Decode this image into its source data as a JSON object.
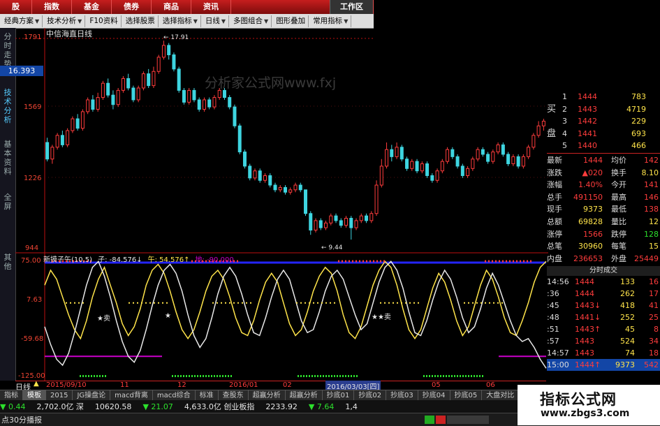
{
  "topbar": {
    "tabs": [
      "股",
      "指数",
      "基金",
      "债券",
      "商品",
      "资讯"
    ],
    "workspace": "工作区"
  },
  "toolbar": {
    "buttons": [
      "经典方案",
      "技术分析",
      "F10资料",
      "选择股票",
      "选择指标",
      "日线",
      "多图组合",
      "图形叠加",
      "常用指标"
    ]
  },
  "sidebar": {
    "labels": [
      "分时走势",
      "技术分析",
      "基本资料",
      "全屏",
      "其他"
    ],
    "price_tag": "16.393"
  },
  "chart": {
    "title": "中信海直日线",
    "y_labels": [
      "1791",
      "1569",
      "1226",
      "944"
    ],
    "high_label": "17.91",
    "low_label": "9.44",
    "faint_watermark": "分析家公式网www.fxj"
  },
  "indicator": {
    "legend": [
      "新摸子午(10,5)",
      "子: -84.576↓",
      "午: 54.576↑",
      "地: -90.000"
    ],
    "y_labels": [
      "75.00",
      "7.63",
      "-59.68",
      "-125.00"
    ],
    "annotations": [
      "★卖",
      "★",
      "★★卖"
    ]
  },
  "dates": {
    "period": "日线",
    "labels": [
      "2015/09/10",
      "11",
      "12",
      "2016/01",
      "02",
      "2016/03/03[四]",
      "05",
      "06"
    ]
  },
  "quote": {
    "book": [
      {
        "side": "",
        "level": "1",
        "price": "1444",
        "vol": "783"
      },
      {
        "side": "买",
        "level": "2",
        "price": "1443",
        "vol": "4719"
      },
      {
        "side": "",
        "level": "3",
        "price": "1442",
        "vol": "229"
      },
      {
        "side": "盘",
        "level": "4",
        "price": "1441",
        "vol": "693"
      },
      {
        "side": "",
        "level": "5",
        "price": "1440",
        "vol": "466"
      }
    ],
    "stats": [
      {
        "k1": "最新",
        "v1": "1444",
        "k2": "均价",
        "v2": "142"
      },
      {
        "k1": "涨跌",
        "v1": "▲020",
        "k2": "换手",
        "v2": "8.10"
      },
      {
        "k1": "涨幅",
        "v1": "1.40%",
        "k2": "今开",
        "v2": "141"
      },
      {
        "k1": "总手",
        "v1": "491150",
        "k2": "最高",
        "v2": "146"
      },
      {
        "k1": "现手",
        "v1": "9373",
        "k2": "最低",
        "v2": "138"
      },
      {
        "k1": "总额",
        "v1": "69828",
        "k2": "量比",
        "v2": "12"
      },
      {
        "k1": "涨停",
        "v1": "1566",
        "k2": "跌停",
        "v2": "128"
      },
      {
        "k1": "总笔",
        "v1": "30960",
        "k2": "每笔",
        "v2": "15"
      },
      {
        "k1": "内盘",
        "v1": "236653",
        "k2": "外盘",
        "v2": "25449"
      }
    ],
    "trades_title": "分时成交",
    "trades": [
      {
        "t": "14:56",
        "p": "1444",
        "v": "133",
        "n": "16"
      },
      {
        "t": ":36",
        "p": "1444",
        "v": "262",
        "n": "17"
      },
      {
        "t": ":45",
        "p": "1443↓",
        "v": "418",
        "n": "41"
      },
      {
        "t": ":48",
        "p": "1441↓",
        "v": "252",
        "n": "25"
      },
      {
        "t": ":51",
        "p": "1443↑",
        "v": "45",
        "n": "8"
      },
      {
        "t": ":57",
        "p": "1443",
        "v": "524",
        "n": "34"
      },
      {
        "t": "14:57",
        "p": "1443",
        "v": "74",
        "n": "18"
      },
      {
        "t": "15:00",
        "p": "1444↑",
        "v": "9373",
        "n": "542"
      }
    ]
  },
  "bottom_tabs": [
    "指标",
    "模板",
    "2015",
    "JG操盘论",
    "macd背离",
    "macd综合",
    "标准",
    "查股东",
    "超赢分析",
    "超赢分析",
    "抄底01",
    "抄底02",
    "抄底03",
    "抄底04",
    "抄底05",
    "大盘对比",
    "其"
  ],
  "ticker": [
    {
      "text": "▼ 0.44",
      "color": "#2ce02c"
    },
    {
      "text": "2,702.0亿 深",
      "color": "#e6e6e6"
    },
    {
      "text": "10620.58",
      "color": "#e6e6e6"
    },
    {
      "text": "▼ 21.07",
      "color": "#2ce02c"
    },
    {
      "text": "4,633.0亿 创业板指",
      "color": "#e6e6e6"
    },
    {
      "text": "2233.92",
      "color": "#e6e6e6"
    },
    {
      "text": "▼ 7.64",
      "color": "#2ce02c"
    },
    {
      "text": "1,4",
      "color": "#e6e6e6"
    }
  ],
  "bottombar": {
    "text": "点30分播报"
  },
  "watermark": {
    "title": "指标公式网",
    "url": "www.zbgs3.com"
  },
  "chart_data": {
    "type": "candlestick",
    "price_ylim": [
      9.0,
      18.2
    ],
    "candles": [
      [
        13.6,
        12.9,
        13.8,
        12.8
      ],
      [
        12.9,
        13.4,
        13.5,
        12.7
      ],
      [
        13.4,
        13.9,
        14.0,
        13.3
      ],
      [
        13.9,
        13.5,
        14.1,
        13.4
      ],
      [
        13.5,
        14.1,
        14.2,
        13.4
      ],
      [
        14.1,
        14.6,
        14.7,
        14.0
      ],
      [
        14.6,
        14.2,
        14.8,
        14.1
      ],
      [
        14.2,
        14.9,
        15.0,
        14.1
      ],
      [
        14.9,
        15.4,
        15.5,
        14.8
      ],
      [
        15.4,
        15.0,
        15.6,
        14.9
      ],
      [
        15.0,
        15.5,
        15.7,
        14.9
      ],
      [
        15.5,
        16.1,
        16.2,
        15.4
      ],
      [
        16.1,
        15.6,
        16.3,
        15.5
      ],
      [
        15.6,
        15.2,
        15.8,
        15.0
      ],
      [
        15.2,
        15.8,
        15.9,
        15.1
      ],
      [
        15.8,
        16.3,
        16.4,
        15.7
      ],
      [
        16.3,
        15.9,
        16.5,
        15.8
      ],
      [
        15.9,
        15.4,
        16.0,
        15.3
      ],
      [
        15.4,
        15.9,
        16.0,
        15.3
      ],
      [
        15.9,
        16.5,
        16.6,
        15.8
      ],
      [
        16.5,
        16.0,
        16.7,
        15.9
      ],
      [
        16.0,
        16.6,
        16.8,
        15.9
      ],
      [
        16.6,
        17.2,
        17.3,
        16.5
      ],
      [
        17.2,
        17.7,
        17.9,
        17.1
      ],
      [
        17.7,
        17.3,
        17.8,
        17.1
      ],
      [
        17.3,
        16.7,
        17.4,
        16.6
      ],
      [
        16.7,
        15.8,
        16.8,
        15.7
      ],
      [
        15.8,
        15.3,
        15.9,
        15.2
      ],
      [
        15.3,
        15.8,
        15.9,
        15.2
      ],
      [
        15.8,
        15.4,
        15.9,
        15.3
      ],
      [
        15.4,
        15.0,
        15.5,
        14.9
      ],
      [
        15.0,
        15.4,
        15.5,
        14.9
      ],
      [
        15.4,
        15.1,
        15.5,
        15.0
      ],
      [
        15.1,
        15.5,
        15.6,
        15.0
      ],
      [
        15.5,
        15.8,
        15.9,
        15.4
      ],
      [
        15.8,
        15.5,
        15.9,
        15.4
      ],
      [
        15.5,
        15.1,
        15.6,
        15.0
      ],
      [
        15.1,
        14.3,
        15.2,
        14.2
      ],
      [
        14.3,
        13.2,
        14.4,
        13.1
      ],
      [
        13.2,
        12.6,
        13.3,
        12.5
      ],
      [
        12.6,
        12.1,
        12.7,
        12.0
      ],
      [
        12.1,
        12.4,
        12.5,
        12.0
      ],
      [
        12.4,
        12.0,
        12.5,
        11.9
      ],
      [
        12.0,
        12.2,
        12.3,
        11.9
      ],
      [
        12.2,
        11.8,
        12.3,
        11.7
      ],
      [
        11.8,
        11.6,
        11.9,
        11.5
      ],
      [
        11.6,
        11.7,
        11.8,
        11.5
      ],
      [
        11.7,
        11.5,
        11.8,
        11.4
      ],
      [
        11.5,
        11.6,
        11.7,
        11.4
      ],
      [
        11.6,
        11.8,
        11.9,
        11.5
      ],
      [
        11.8,
        11.6,
        11.9,
        11.5
      ],
      [
        11.6,
        10.6,
        11.6,
        10.5
      ],
      [
        10.6,
        9.9,
        10.7,
        9.7
      ],
      [
        9.9,
        10.3,
        10.4,
        9.8
      ],
      [
        10.3,
        10.0,
        10.4,
        9.9
      ],
      [
        10.0,
        10.2,
        10.3,
        9.9
      ],
      [
        10.2,
        10.5,
        10.6,
        10.1
      ],
      [
        10.5,
        10.3,
        10.6,
        10.2
      ],
      [
        10.3,
        10.1,
        10.4,
        10.0
      ],
      [
        10.1,
        10.4,
        10.5,
        10.0
      ],
      [
        10.4,
        10.0,
        10.5,
        9.5
      ],
      [
        10.0,
        10.3,
        10.4,
        9.9
      ],
      [
        10.3,
        10.5,
        10.6,
        10.2
      ],
      [
        10.5,
        10.3,
        10.6,
        10.2
      ],
      [
        10.3,
        10.6,
        10.7,
        10.2
      ],
      [
        10.6,
        11.8,
        12.0,
        10.5
      ],
      [
        11.8,
        12.6,
        12.9,
        11.7
      ],
      [
        12.6,
        13.3,
        13.6,
        12.5
      ],
      [
        13.3,
        13.0,
        13.5,
        12.8
      ],
      [
        13.0,
        13.4,
        13.6,
        12.9
      ],
      [
        13.4,
        12.9,
        13.5,
        12.8
      ],
      [
        12.9,
        12.5,
        13.0,
        12.4
      ],
      [
        12.5,
        12.8,
        12.9,
        12.4
      ],
      [
        12.8,
        12.4,
        12.9,
        12.3
      ],
      [
        12.4,
        12.7,
        12.8,
        12.3
      ],
      [
        12.7,
        12.2,
        12.8,
        12.1
      ],
      [
        12.2,
        12.0,
        12.3,
        11.9
      ],
      [
        12.0,
        12.4,
        12.5,
        11.9
      ],
      [
        12.4,
        12.8,
        12.9,
        12.3
      ],
      [
        12.8,
        13.3,
        13.4,
        12.7
      ],
      [
        13.3,
        13.0,
        13.4,
        12.9
      ],
      [
        13.0,
        12.6,
        13.1,
        12.5
      ],
      [
        12.6,
        12.2,
        12.7,
        12.1
      ],
      [
        12.2,
        12.5,
        12.6,
        12.1
      ],
      [
        12.5,
        12.9,
        13.0,
        12.4
      ],
      [
        12.9,
        13.3,
        13.4,
        12.8
      ],
      [
        13.3,
        13.1,
        13.4,
        13.0
      ],
      [
        13.1,
        12.8,
        13.2,
        12.7
      ],
      [
        12.8,
        13.2,
        13.3,
        12.7
      ],
      [
        13.2,
        13.5,
        13.6,
        13.1
      ],
      [
        13.5,
        13.1,
        13.6,
        13.0
      ],
      [
        13.1,
        12.7,
        13.2,
        12.6
      ],
      [
        12.7,
        13.0,
        13.1,
        12.6
      ],
      [
        13.0,
        12.6,
        13.1,
        12.5
      ],
      [
        12.6,
        13.0,
        13.1,
        12.5
      ],
      [
        13.0,
        13.4,
        13.5,
        12.9
      ],
      [
        13.4,
        13.9,
        14.0,
        13.3
      ],
      [
        13.9,
        14.3,
        14.5,
        13.8
      ],
      [
        14.3,
        14.5,
        14.6,
        14.1
      ]
    ],
    "indicator_ylim": [
      -125,
      75
    ],
    "osc_yellow": [
      30,
      55,
      40,
      10,
      -20,
      -45,
      -60,
      -30,
      10,
      40,
      60,
      30,
      0,
      -35,
      -55,
      -40,
      -10,
      30,
      55,
      65,
      50,
      20,
      -15,
      -45,
      -60,
      -45,
      -15,
      20,
      45,
      55,
      40,
      10,
      -25,
      -50,
      -55,
      -30,
      5,
      35,
      50,
      35,
      0,
      -35,
      -55,
      -45,
      -15,
      20,
      45,
      60,
      50,
      20,
      -20,
      -50,
      -60,
      -40,
      -5,
      30,
      55,
      70,
      60,
      30,
      -10,
      -45,
      -60,
      -45,
      -10,
      25,
      50,
      35,
      5,
      -30,
      -55,
      -40,
      -5,
      30,
      55,
      40,
      10,
      -25,
      -50,
      -55,
      -30,
      0,
      35,
      60,
      70
    ],
    "osc_white": [
      -40,
      -70,
      -95,
      -105,
      -85,
      -50,
      -10,
      30,
      60,
      70,
      45,
      10,
      -30,
      -65,
      -90,
      -100,
      -80,
      -45,
      -5,
      30,
      55,
      65,
      50,
      20,
      -20,
      -55,
      -75,
      -60,
      -25,
      15,
      45,
      60,
      45,
      15,
      -20,
      -50,
      -55,
      -25,
      10,
      40,
      55,
      40,
      5,
      -30,
      -50,
      -45,
      -15,
      20,
      45,
      55,
      40,
      10,
      -20,
      -45,
      -35,
      0,
      35,
      60,
      70,
      55,
      25,
      -15,
      -50,
      -55,
      -30,
      5,
      35,
      55,
      40,
      10,
      -25,
      -50,
      -40,
      -10,
      25,
      50,
      30,
      0,
      -30,
      -55,
      -65,
      -60,
      -75,
      -95,
      -110
    ]
  }
}
